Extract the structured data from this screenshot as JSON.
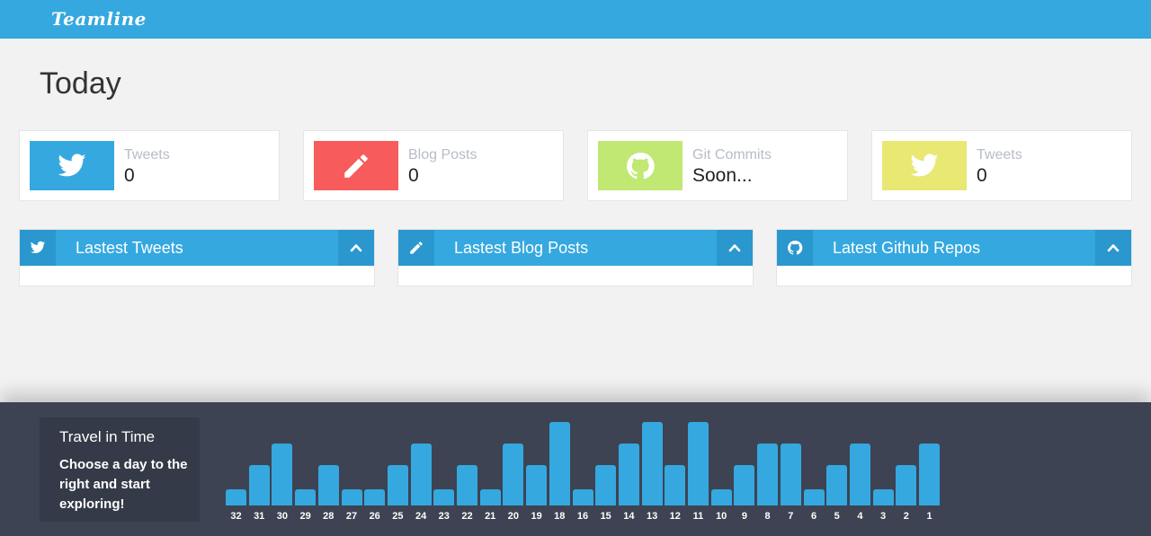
{
  "header": {
    "brand": "Teamline",
    "color": "#35a8e0"
  },
  "page": {
    "title": "Today"
  },
  "stats": [
    {
      "label": "Tweets",
      "value": "0",
      "icon": "twitter-icon",
      "color": "#35a8e0"
    },
    {
      "label": "Blog Posts",
      "value": "0",
      "icon": "pencil-icon",
      "color": "#f75b5b"
    },
    {
      "label": "Git Commits",
      "value": "Soon...",
      "icon": "github-icon",
      "color": "#c0e873"
    },
    {
      "label": "Tweets",
      "value": "0",
      "icon": "twitter-icon",
      "color": "#e8e873"
    }
  ],
  "panels": [
    {
      "title": "Lastest Tweets",
      "icon": "twitter-icon",
      "toggle_icon": "chevron-up-icon"
    },
    {
      "title": "Lastest Blog Posts",
      "icon": "pencil-icon",
      "toggle_icon": "chevron-up-icon"
    },
    {
      "title": "Latest Github Repos",
      "icon": "github-icon",
      "toggle_icon": "chevron-up-icon"
    }
  ],
  "travel": {
    "title": "Travel in Time",
    "text": "Choose a day to the right and start exploring!"
  },
  "timeline": {
    "days": [
      "32",
      "31",
      "30",
      "29",
      "28",
      "27",
      "26",
      "25",
      "24",
      "23",
      "22",
      "21",
      "20",
      "19",
      "18",
      "16",
      "15",
      "14",
      "13",
      "12",
      "11",
      "10",
      "9",
      "8",
      "7",
      "6",
      "5",
      "4",
      "3",
      "2",
      "1"
    ],
    "levels": [
      1,
      2,
      3,
      1,
      2,
      1,
      1,
      2,
      3,
      1,
      2,
      1,
      3,
      2,
      4,
      1,
      2,
      3,
      4,
      2,
      4,
      1,
      2,
      3,
      3,
      1,
      2,
      3,
      1,
      2,
      3
    ],
    "max_level": 4
  }
}
